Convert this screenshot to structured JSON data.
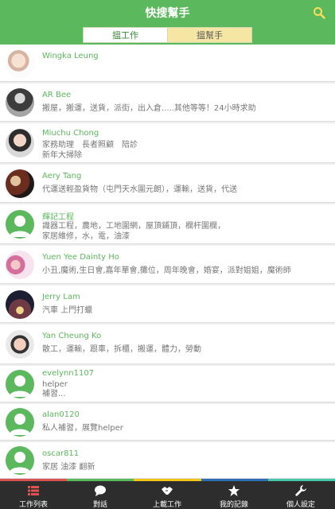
{
  "header": {
    "title": "快搜幫手",
    "search_icon": "search-icon",
    "tabs": [
      {
        "label": "搵工作",
        "active": true
      },
      {
        "label": "搵幫手",
        "active": false
      }
    ]
  },
  "list": [
    {
      "name": "Wingka Leung",
      "desc": [],
      "avatar": "photo1"
    },
    {
      "name": "AR Bee",
      "desc": [
        "搬屋，搬運，送貨，派街，出入倉.....其他等等！24小時求助"
      ],
      "avatar": "photo2"
    },
    {
      "name": "Miuchu Chong",
      "desc": [
        "家務助理　長者照顧　陪診",
        "新年大掃除"
      ],
      "avatar": "photo3"
    },
    {
      "name": "Aery Tang",
      "desc": [
        "代運送輕盈貨物（屯門天水圍元朗），運輸，送貨，代送"
      ],
      "avatar": "photo4"
    },
    {
      "name": "輝記工程",
      "desc": [
        "識器工程，農地，工地圍網，屋頂鋪頂，欄杆圍欄，",
        "家居維修，水，電，油漆"
      ],
      "avatar": "default"
    },
    {
      "name": "Yuen Yee Dainty Ho",
      "desc": [
        "小丑,魔術,生日會,嘉年華會,攤位，周年晚會，婚宴，派對姐姐，魔術師"
      ],
      "avatar": "photo5"
    },
    {
      "name": "Jerry Lam",
      "desc": [
        "汽車 上門打蠟"
      ],
      "avatar": "photo6"
    },
    {
      "name": "Yan Cheung Ko",
      "desc": [
        "散工，運輸，跟車，拆櫃，搬運，體力，勞動"
      ],
      "avatar": "photo7"
    },
    {
      "name": "evelynn1107",
      "desc": [
        "helper",
        "補習..."
      ],
      "avatar": "default"
    },
    {
      "name": "alan0120",
      "desc": [
        "私人補習，展覽helper"
      ],
      "avatar": "default"
    },
    {
      "name": "oscar811",
      "desc": [
        "家居 油漆 翻新"
      ],
      "avatar": "default"
    }
  ],
  "tabbar": {
    "stripe_colors": [
      "#d9534f",
      "#5cb85c",
      "#f0c419",
      "#2f6db5",
      "#45c7a8"
    ],
    "items": [
      {
        "label": "工作列表",
        "icon": "list-icon"
      },
      {
        "label": "對話",
        "icon": "chat-bubble-icon"
      },
      {
        "label": "上載工作",
        "icon": "handshake-icon"
      },
      {
        "label": "我的記錄",
        "icon": "star-icon"
      },
      {
        "label": "個人設定",
        "icon": "wrench-icon"
      }
    ]
  }
}
